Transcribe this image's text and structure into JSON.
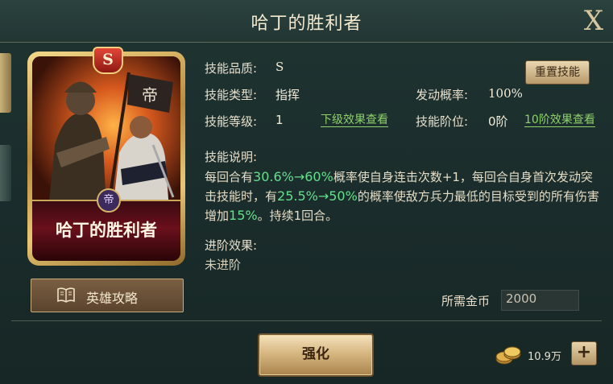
{
  "header": {
    "title": "哈丁的胜利者",
    "close_label": "X"
  },
  "card": {
    "rank": "S",
    "name": "哈丁的胜利者",
    "faction_glyph": "帝"
  },
  "guide_button": {
    "label": "英雄攻略"
  },
  "info": {
    "quality_label": "技能品质:",
    "quality_value": "S",
    "type_label": "技能类型:",
    "type_value": "指挥",
    "chance_label": "发动概率:",
    "chance_value": "100%",
    "level_label": "技能等级:",
    "level_value": "1",
    "next_effect_link": "下级效果查看",
    "tier_label": "技能阶位:",
    "tier_value": "0阶",
    "tier10_link": "10阶效果查看",
    "reset_button": "重置技能"
  },
  "description": {
    "heading": "技能说明:",
    "p1": "每回合有",
    "hl1": "30.6%→60%",
    "p2": "概率使自身连击次数+1，每回合自身首次发动突击技能时，有",
    "hl2": "25.5%→50%",
    "p3": "的概率使敌方兵力最低的目标受到的所有伤害增加",
    "hl3": "15%",
    "p4": "。持续1回合。"
  },
  "advance": {
    "heading": "进阶效果:",
    "value": "未进阶"
  },
  "cost": {
    "label": "所需金币",
    "value": "2000"
  },
  "actions": {
    "strengthen": "强化"
  },
  "wallet": {
    "coins": "10.9万",
    "add": "+"
  },
  "colors": {
    "highlight": "#63e08a",
    "link": "#8ed06a",
    "gold_frame": "#d9b466",
    "title_text": "#f3e9cf"
  },
  "icons": {
    "close": "close-icon",
    "book": "book-icon",
    "coins": "coins-icon",
    "plus": "plus-icon"
  }
}
